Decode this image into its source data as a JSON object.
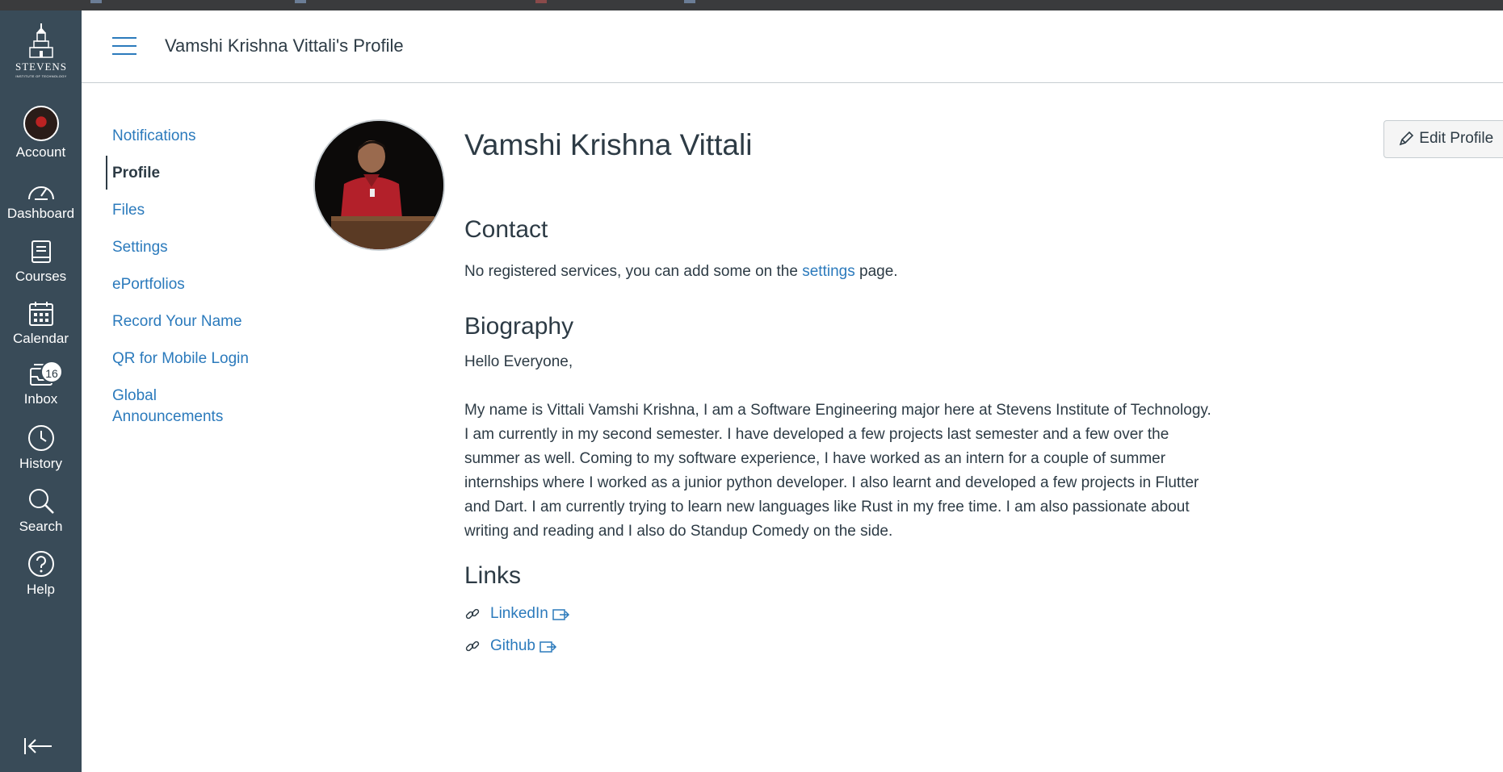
{
  "header": {
    "title": "Vamshi Krishna Vittali's Profile"
  },
  "globalnav": {
    "logo": {
      "word": "STEVENS",
      "sub": "INSTITUTE OF TECHNOLOGY"
    },
    "items": [
      {
        "label": "Account",
        "icon": "user-avatar-icon"
      },
      {
        "label": "Dashboard",
        "icon": "gauge-icon"
      },
      {
        "label": "Courses",
        "icon": "book-icon"
      },
      {
        "label": "Calendar",
        "icon": "calendar-icon"
      },
      {
        "label": "Inbox",
        "icon": "inbox-icon",
        "badge": "16"
      },
      {
        "label": "History",
        "icon": "clock-icon"
      },
      {
        "label": "Search",
        "icon": "search-icon"
      },
      {
        "label": "Help",
        "icon": "question-icon"
      }
    ]
  },
  "subnav": {
    "items": [
      {
        "label": "Notifications"
      },
      {
        "label": "Profile",
        "active": true
      },
      {
        "label": "Files"
      },
      {
        "label": "Settings"
      },
      {
        "label": "ePortfolios"
      },
      {
        "label": "Record Your Name"
      },
      {
        "label": "QR for Mobile Login"
      },
      {
        "label": "Global Announcements"
      }
    ]
  },
  "profile": {
    "name": "Vamshi Krishna Vittali",
    "edit_label": "Edit Profile",
    "contact": {
      "heading": "Contact",
      "text_before": "No registered services, you can add some on the ",
      "link": "settings",
      "text_after": " page."
    },
    "biography": {
      "heading": "Biography",
      "greeting": "Hello Everyone,",
      "body": "My name is Vittali Vamshi Krishna, I am a Software Engineering major here at Stevens Institute of Technology. I am currently in my second semester. I have developed a few projects last semester and a few over the summer as well. Coming to my software experience, I have worked as an intern for a couple of summer internships where I worked as a junior python developer. I also learnt and developed a few projects in Flutter and Dart. I am currently trying to learn new languages like Rust in my free time. I am also passionate about writing and reading and I also do Standup Comedy on the side."
    },
    "links": {
      "heading": "Links",
      "items": [
        {
          "label": "LinkedIn"
        },
        {
          "label": "Github"
        }
      ]
    }
  },
  "colors": {
    "nav_bg": "#394b58",
    "link": "#2b7abc",
    "text": "#2d3b45"
  }
}
